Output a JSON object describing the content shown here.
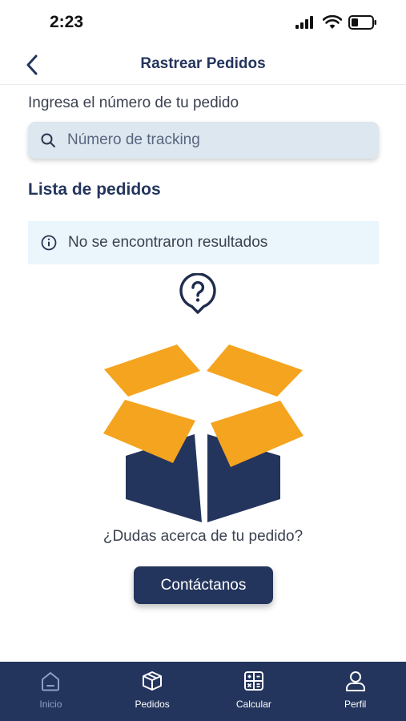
{
  "status_bar": {
    "time": "2:23",
    "icons": [
      "signal-icon",
      "wifi-icon",
      "battery-icon"
    ]
  },
  "header": {
    "title": "Rastrear Pedidos",
    "back_icon": "chevron-left-icon"
  },
  "search": {
    "label": "Ingresa el número de tu pedido",
    "placeholder": "Número de tracking",
    "value": ""
  },
  "orders": {
    "title": "Lista de pedidos",
    "empty_message": "No se encontraron resultados"
  },
  "empty_state": {
    "question": "¿Dudas acerca de tu pedido?",
    "contact_label": "Contáctanos"
  },
  "nav": {
    "items": [
      {
        "label": "Inicio",
        "icon": "home-icon",
        "active": false
      },
      {
        "label": "Pedidos",
        "icon": "box-icon",
        "active": true
      },
      {
        "label": "Calcular",
        "icon": "calculator-icon",
        "active": true
      },
      {
        "label": "Perfil",
        "icon": "user-icon",
        "active": true
      }
    ]
  },
  "colors": {
    "primary": "#24355d",
    "accent": "#f4a41f",
    "search_bg": "#dde7ef",
    "info_bg": "#eaf5fc"
  }
}
